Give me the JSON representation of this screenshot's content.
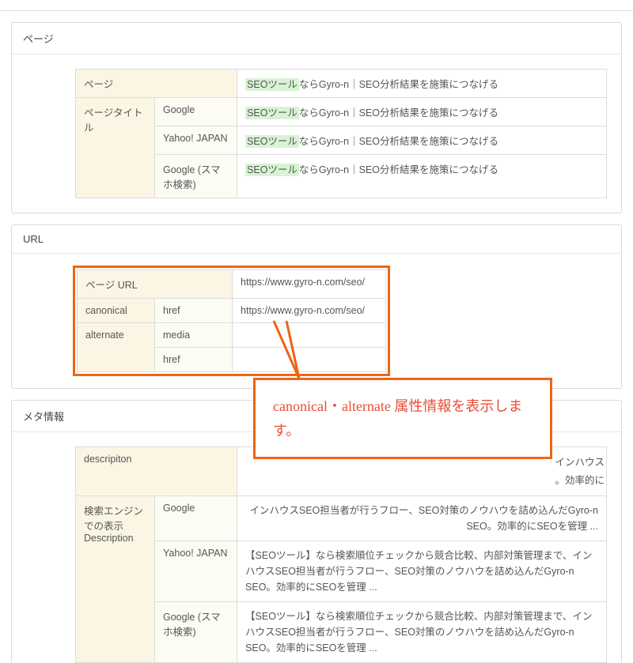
{
  "panel_page": {
    "title": "ページ",
    "rows": [
      {
        "label1": "ページ",
        "label2": null,
        "value_prefix_hl": "SEOツール",
        "value_rest": "ならGyro-n｜SEO分析結果を施策につなげる"
      },
      {
        "label1": "ページタイトル",
        "label2": "Google",
        "value_prefix_hl": "SEOツール",
        "value_rest": "ならGyro-n｜SEO分析結果を施策につなげる"
      },
      {
        "label1": null,
        "label2": "Yahoo! JAPAN",
        "value_prefix_hl": "SEOツール",
        "value_rest": "ならGyro-n｜SEO分析結果を施策につなげる"
      },
      {
        "label1": null,
        "label2": "Google (スマホ検索)",
        "value_prefix_hl": "SEOツール",
        "value_rest": "ならGyro-n｜SEO分析結果を施策につなげる"
      }
    ]
  },
  "panel_url": {
    "title": "URL",
    "rows": [
      {
        "label1": "ページ URL",
        "label2": null,
        "value": "https://www.gyro-n.com/seo/"
      },
      {
        "label1": "canonical",
        "label2": "href",
        "value": "https://www.gyro-n.com/seo/"
      },
      {
        "label1": "alternate",
        "label2": "media",
        "value": ""
      },
      {
        "label1": null,
        "label2": "href",
        "value": ""
      }
    ]
  },
  "panel_meta": {
    "title": "メタ情報",
    "rows": [
      {
        "label1": "descripiton",
        "label2": null,
        "value_full": "インハウス 。効率的に"
      },
      {
        "label1": "検索エンジンでの表示\nDescription",
        "label2": "Google",
        "value_full": "インハウスSEO担当者が行うフロー、SEO対策のノウハウを詰め込んだGyro-n SEO。効率的にSEOを管理 ..."
      },
      {
        "label1": null,
        "label2": "Yahoo! JAPAN",
        "value_full": "【SEOツール】なら検索順位チェックから競合比較、内部対策管理まで、インハウスSEO担当者が行うフロー、SEO対策のノウハウを詰め込んだGyro-n SEO。効率的にSEOを管理 ..."
      },
      {
        "label1": null,
        "label2": "Google (スマホ検索)",
        "value_full": "【SEOツール】なら検索順位チェックから競合比較、内部対策管理まで、インハウスSEO担当者が行うフロー、SEO対策のノウハウを詰め込んだGyro-n SEO。効率的にSEOを管理 ..."
      }
    ]
  },
  "annotation": {
    "text": "canonical・alternate 属性情報を表示します。"
  }
}
